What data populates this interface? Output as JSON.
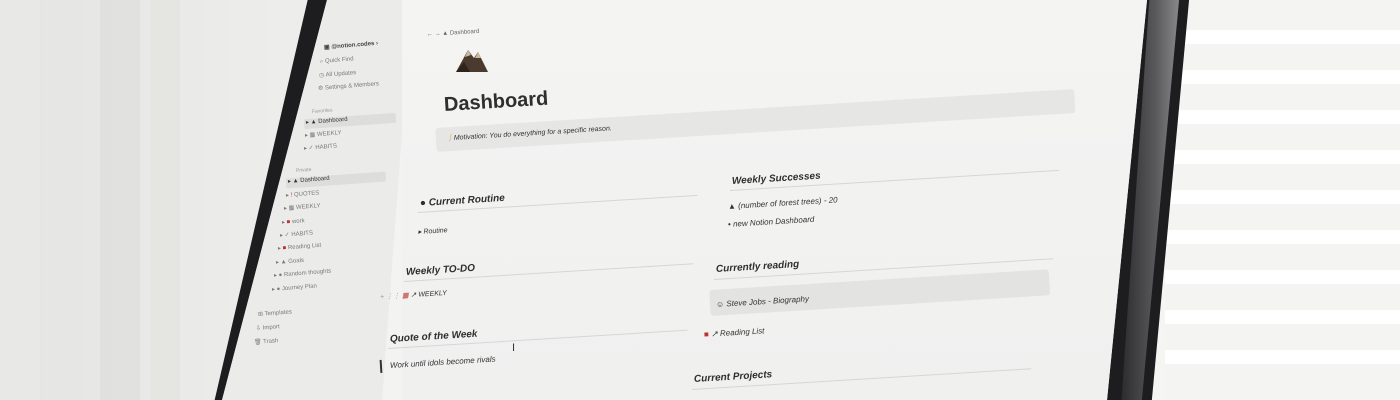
{
  "sidebar": {
    "workspace": "@notion.codes",
    "top_items": [
      {
        "icon": "search-icon",
        "glyph": "⌕",
        "label": "Quick Find"
      },
      {
        "icon": "clock-icon",
        "glyph": "◷",
        "label": "All Updates"
      },
      {
        "icon": "gear-icon",
        "glyph": "⚙",
        "label": "Settings & Members"
      }
    ],
    "favorites_label": "Favorites",
    "favorites": [
      {
        "icon": "mountain-icon",
        "glyph": "▲",
        "label": "Dashboard"
      },
      {
        "icon": "calendar-icon",
        "glyph": "▦",
        "label": "WEEKLY"
      },
      {
        "icon": "check-icon",
        "glyph": "✓",
        "label": "HABITS"
      }
    ],
    "private_label": "Private",
    "private": [
      {
        "icon": "mountain-icon",
        "glyph": "▲",
        "label": "Dashboard"
      },
      {
        "icon": "exclamation-icon",
        "glyph": "!",
        "label": "QUOTES"
      },
      {
        "icon": "calendar-icon",
        "glyph": "▦",
        "label": "WEEKLY"
      },
      {
        "icon": "work-icon",
        "glyph": "■",
        "label": "work"
      },
      {
        "icon": "check-icon",
        "glyph": "✓",
        "label": "HABITS"
      },
      {
        "icon": "book-icon",
        "glyph": "■",
        "label": "Reading List"
      },
      {
        "icon": "mountain-icon",
        "glyph": "▲",
        "label": "Goals"
      },
      {
        "icon": "thought-icon",
        "glyph": "●",
        "label": "Random thoughts"
      },
      {
        "icon": "car-icon",
        "glyph": "●",
        "label": "Journey Plan"
      }
    ],
    "bottom_items": [
      {
        "icon": "templates-icon",
        "glyph": "⊞",
        "label": "Templates"
      },
      {
        "icon": "import-icon",
        "glyph": "⇩",
        "label": "Import"
      },
      {
        "icon": "trash-icon",
        "glyph": "🗑",
        "label": "Trash"
      }
    ]
  },
  "topbar": {
    "breadcrumb": "Dashboard"
  },
  "page": {
    "title": "Dashboard",
    "callout": "Motivation: You do everything for a specific reason.",
    "current_routine": {
      "heading": "Current Routine",
      "toggle": "Routine"
    },
    "weekly_todo": {
      "heading": "Weekly TO-DO",
      "link": "WEEKLY"
    },
    "quote": {
      "heading": "Quote of the Week",
      "text": "Work until idols become rivals"
    },
    "weekly_successes": {
      "heading": "Weekly Successes",
      "items": [
        "(number of forest trees) - 20",
        "new Notion Dashboard"
      ]
    },
    "currently_reading": {
      "heading": "Currently reading",
      "book": "Steve Jobs - Biography",
      "link": "Reading List"
    },
    "current_projects": {
      "heading": "Current Projects"
    }
  },
  "colors": {
    "sidebar_bg": "#ebebea",
    "page_bg": "#f3f3f2",
    "text": "#2f2f2d"
  }
}
